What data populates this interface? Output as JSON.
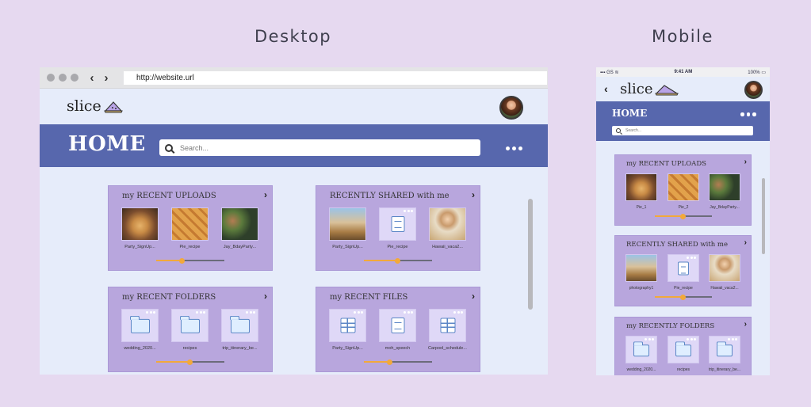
{
  "headings": {
    "desktop": "Desktop",
    "mobile": "Mobile"
  },
  "desktop": {
    "browser": {
      "url": "http://website.url",
      "back": "‹",
      "forward": "›"
    },
    "logo": "slice",
    "page_title": "HOME",
    "search_placeholder": "Search...",
    "cards": [
      {
        "title": "my RECENT UPLOADS",
        "progress": 0.38,
        "items": [
          {
            "label": "Party_SignUp...",
            "kind": "photo",
            "style": "photo1"
          },
          {
            "label": "Pie_recipe",
            "kind": "photo",
            "style": "photo2"
          },
          {
            "label": "Jay_BdayParty...",
            "kind": "photo",
            "style": "photo3"
          }
        ]
      },
      {
        "title": "RECENTLY SHARED with me",
        "progress": 0.49,
        "items": [
          {
            "label": "Party_SignUp...",
            "kind": "photo",
            "style": "photo4"
          },
          {
            "label": "Pie_recipe",
            "kind": "doc"
          },
          {
            "label": "Hawaii_vaca2...",
            "kind": "photo",
            "style": "photo5"
          }
        ]
      },
      {
        "title": "my RECENT FOLDERS",
        "progress": 0.49,
        "items": [
          {
            "label": "wedding_2020...",
            "kind": "folder"
          },
          {
            "label": "recipes",
            "kind": "folder"
          },
          {
            "label": "trip_itinerary_be...",
            "kind": "folder"
          }
        ]
      },
      {
        "title": "my RECENT FILES",
        "progress": 0.38,
        "items": [
          {
            "label": "Party_SignUp...",
            "kind": "sheet"
          },
          {
            "label": "moh_speech",
            "kind": "doc"
          },
          {
            "label": "Carpool_schedule...",
            "kind": "sheet"
          }
        ]
      }
    ]
  },
  "mobile": {
    "status": {
      "carrier": "GS",
      "time": "9:41 AM",
      "battery": "100%"
    },
    "back": "‹",
    "logo": "slice",
    "page_title": "HOME",
    "search_placeholder": "Search...",
    "cards": [
      {
        "title": "my RECENT UPLOADS",
        "progress": 0.49,
        "items": [
          {
            "label": "Pie_1",
            "kind": "photo",
            "style": "photo1"
          },
          {
            "label": "Pie_2",
            "kind": "photo",
            "style": "photo2"
          },
          {
            "label": "Jay_BdayParty...",
            "kind": "photo",
            "style": "photo3"
          }
        ]
      },
      {
        "title": "RECENTLY SHARED with me",
        "progress": 0.49,
        "items": [
          {
            "label": "photography1",
            "kind": "photo",
            "style": "photo4"
          },
          {
            "label": "Pie_recipe",
            "kind": "doc"
          },
          {
            "label": "Hawaii_vaca2...",
            "kind": "photo",
            "style": "photo5"
          }
        ]
      },
      {
        "title": "my RECENTLY FOLDERS",
        "progress": 0.49,
        "items": [
          {
            "label": "wedding_2020...",
            "kind": "folder"
          },
          {
            "label": "recipes",
            "kind": "folder"
          },
          {
            "label": "trip_itinerary_be...",
            "kind": "folder"
          }
        ]
      }
    ]
  },
  "colors": {
    "header": "#5767ad",
    "card": "#b8a6dd",
    "accent": "#f2a93b",
    "background": "#e6d9f0"
  }
}
